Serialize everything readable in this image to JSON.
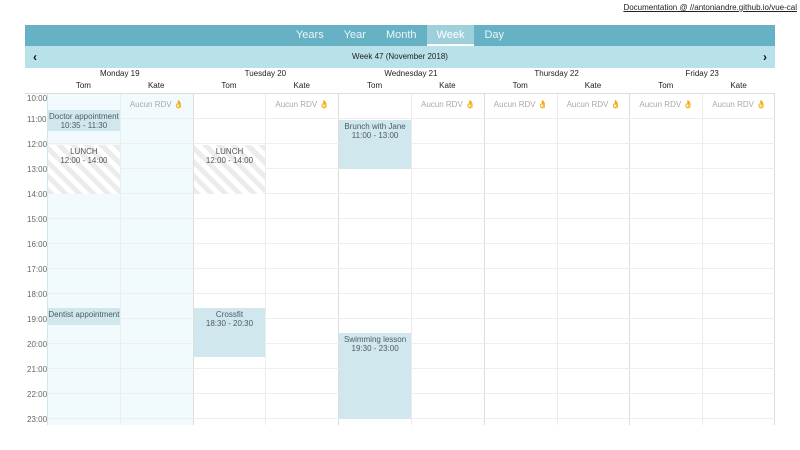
{
  "doc_link": "Documentation @ //antoniandre.github.io/vue-cal",
  "views": [
    {
      "label": "Years",
      "active": false
    },
    {
      "label": "Year",
      "active": false
    },
    {
      "label": "Month",
      "active": false
    },
    {
      "label": "Week",
      "active": true
    },
    {
      "label": "Day",
      "active": false
    }
  ],
  "title": "Week 47 (November 2018)",
  "nav": {
    "prev": "‹",
    "next": "›"
  },
  "split_labels": [
    "Tom",
    "Kate"
  ],
  "days": [
    {
      "name": "Monday 19",
      "today": true
    },
    {
      "name": "Tuesday 20",
      "today": false
    },
    {
      "name": "Wednesday 21",
      "today": false
    },
    {
      "name": "Thursday 22",
      "today": false
    },
    {
      "name": "Friday 23",
      "today": false
    }
  ],
  "times": [
    "10:00",
    "11:00",
    "12:00",
    "13:00",
    "14:00",
    "15:00",
    "16:00",
    "17:00",
    "18:00",
    "19:00",
    "20:00",
    "21:00",
    "22:00",
    "23:00"
  ],
  "all_day_text": "Aucun RDV",
  "all_day_icon": "👌",
  "events": [
    {
      "day": 0,
      "split": 0,
      "title": "Doctor appointment",
      "time": "10:35 - 11:30",
      "start": 10.583,
      "end": 11.5,
      "style": "normal"
    },
    {
      "day": 0,
      "split": 0,
      "title": "LUNCH",
      "time": "12:00 - 14:00",
      "start": 12,
      "end": 14,
      "style": "lunch"
    },
    {
      "day": 1,
      "split": 0,
      "title": "LUNCH",
      "time": "12:00 - 14:00",
      "start": 12,
      "end": 14,
      "style": "lunch"
    },
    {
      "day": 0,
      "split": 0,
      "title": "Dentist appointment",
      "time": "",
      "start": 18.5,
      "end": 19.25,
      "style": "normal"
    },
    {
      "day": 1,
      "split": 0,
      "title": "Crossfit",
      "time": "18:30 - 20:30",
      "start": 18.5,
      "end": 20.5,
      "style": "normal"
    },
    {
      "day": 2,
      "split": 0,
      "title": "Brunch with Jane",
      "time": "11:00 - 13:00",
      "start": 11,
      "end": 13,
      "style": "normal"
    },
    {
      "day": 2,
      "split": 0,
      "title": "Swimming lesson",
      "time": "19:30 - 23:00",
      "start": 19.5,
      "end": 23,
      "style": "normal"
    }
  ],
  "all_day_cells": [
    {
      "day": 0,
      "split": 1
    },
    {
      "day": 1,
      "split": 1
    },
    {
      "day": 2,
      "split": 1
    },
    {
      "day": 3,
      "split": 0
    },
    {
      "day": 3,
      "split": 1
    },
    {
      "day": 4,
      "split": 0
    },
    {
      "day": 4,
      "split": 1
    }
  ]
}
